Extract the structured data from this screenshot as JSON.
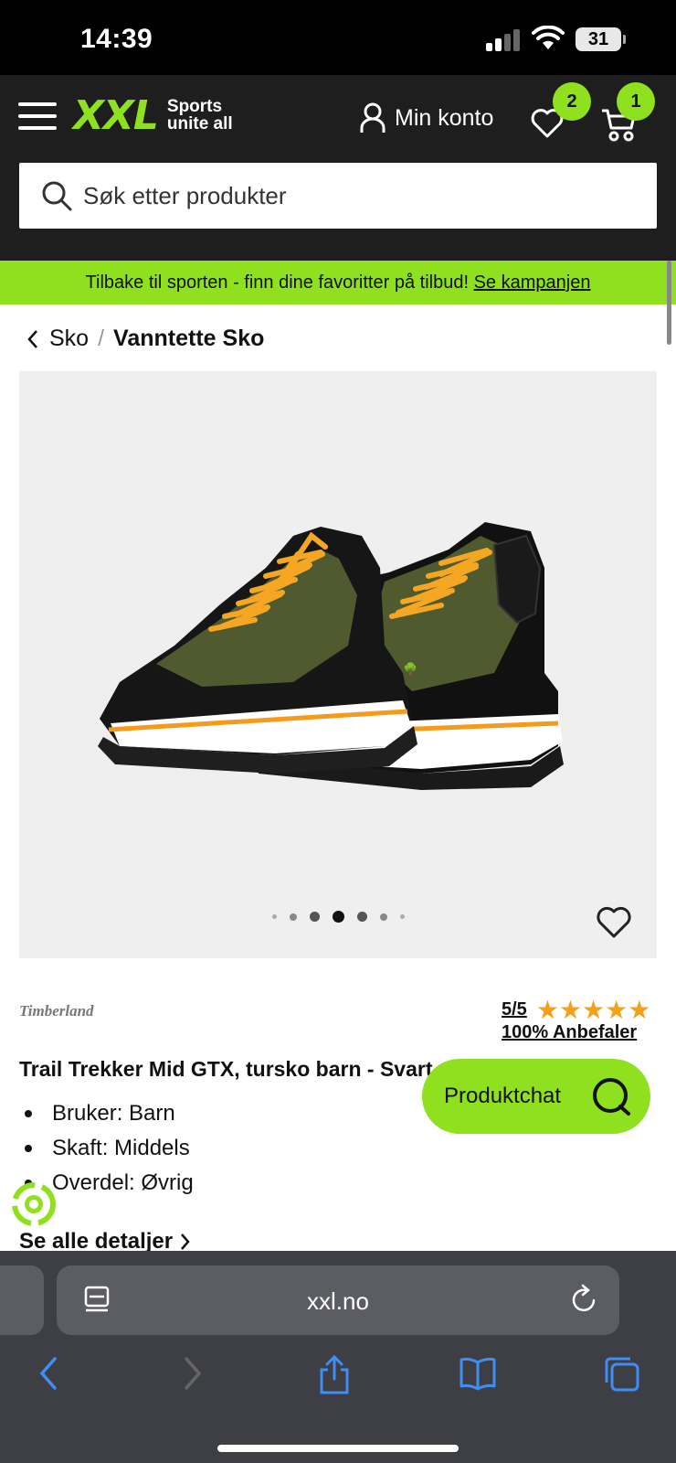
{
  "status_bar": {
    "time": "14:39",
    "battery": "31"
  },
  "header": {
    "logo_text": "XXL",
    "logo_tagline_1": "Sports",
    "logo_tagline_2": "unite all",
    "account_label": "Min konto",
    "wishlist_count": "2",
    "cart_count": "1",
    "search_placeholder": "Søk etter produkter"
  },
  "promo": {
    "text": "Tilbake til sporten - finn dine favoritter på tilbud!",
    "link": "Se kampanjen"
  },
  "breadcrumb": {
    "parent": "Sko",
    "separator": "/",
    "current": "Vanntette Sko"
  },
  "gallery": {
    "image_count": 7,
    "active_index": 3
  },
  "product": {
    "brand": "Timberland",
    "rating": "5/5",
    "stars": "★★★★★",
    "recommend": "100% Anbefaler",
    "title": "Trail Trekker Mid GTX, tursko barn - Svart",
    "features": [
      "Bruker: Barn",
      "Skaft: Middels",
      "Overdel: Øvrig"
    ],
    "details_link": "Se alle detaljer"
  },
  "chat": {
    "label": "Produktchat"
  },
  "browser": {
    "url": "xxl.no"
  },
  "colors": {
    "accent": "#8fe01e",
    "header_bg": "#1e1e1e",
    "star": "#f5a01a",
    "browser_bar": "#3e3f44"
  }
}
